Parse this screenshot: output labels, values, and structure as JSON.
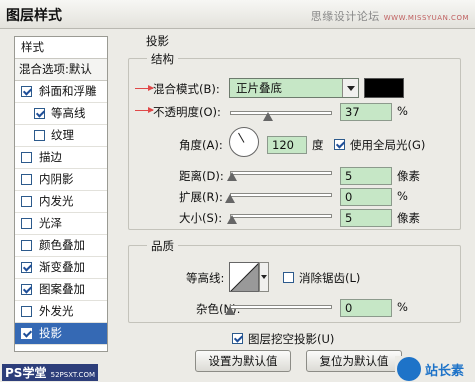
{
  "window": {
    "title": "图层样式",
    "watermark": "思缘设计论坛",
    "watermark_url": "WWW.MISSYUAN.COM"
  },
  "sidebar": {
    "header": "样式",
    "blend_options": "混合选项:默认",
    "items": [
      {
        "label": "斜面和浮雕",
        "checked": true
      },
      {
        "label": "等高线",
        "checked": true
      },
      {
        "label": "纹理",
        "checked": false
      },
      {
        "label": "描边",
        "checked": false
      },
      {
        "label": "内阴影",
        "checked": false
      },
      {
        "label": "内发光",
        "checked": false
      },
      {
        "label": "光泽",
        "checked": false
      },
      {
        "label": "颜色叠加",
        "checked": false
      },
      {
        "label": "渐变叠加",
        "checked": true
      },
      {
        "label": "图案叠加",
        "checked": true
      },
      {
        "label": "外发光",
        "checked": false
      },
      {
        "label": "投影",
        "checked": true
      }
    ]
  },
  "panel": {
    "title": "投影",
    "structure": {
      "title": "结构",
      "blend_mode_label": "混合模式(B):",
      "blend_mode_value": "正片叠底",
      "shadow_color": "#000000",
      "opacity_label": "不透明度(O):",
      "opacity_value": "37",
      "opacity_fraction": 0.37,
      "percent": "%",
      "angle_label": "角度(A):",
      "angle_value": "120",
      "angle_unit": "度",
      "global_light_label": "使用全局光(G)",
      "global_light_checked": true,
      "distance_label": "距离(D):",
      "distance_value": "5",
      "distance_unit": "像素",
      "distance_fraction": 0.02,
      "spread_label": "扩展(R):",
      "spread_value": "0",
      "spread_unit": "%",
      "size_label": "大小(S):",
      "size_value": "5",
      "size_unit": "像素",
      "size_fraction": 0.02
    },
    "quality": {
      "title": "品质",
      "contour_label": "等高线:",
      "anti_alias_label": "消除锯齿(L)",
      "anti_alias_checked": false,
      "noise_label": "杂色(N):",
      "noise_value": "0",
      "noise_unit": "%"
    },
    "knockout_label": "图层挖空投影(U)",
    "knockout_checked": true,
    "buttons": {
      "set_default": "设置为默认值",
      "reset_default": "复位为默认值"
    }
  },
  "watermarks": {
    "left": "PS学堂",
    "left_url": "52PSXT.COM",
    "right": "站长素库"
  },
  "colors": {
    "field_bg": "#c6e7c6",
    "selected_row": "#3569b4",
    "arrow": "#e04848"
  }
}
